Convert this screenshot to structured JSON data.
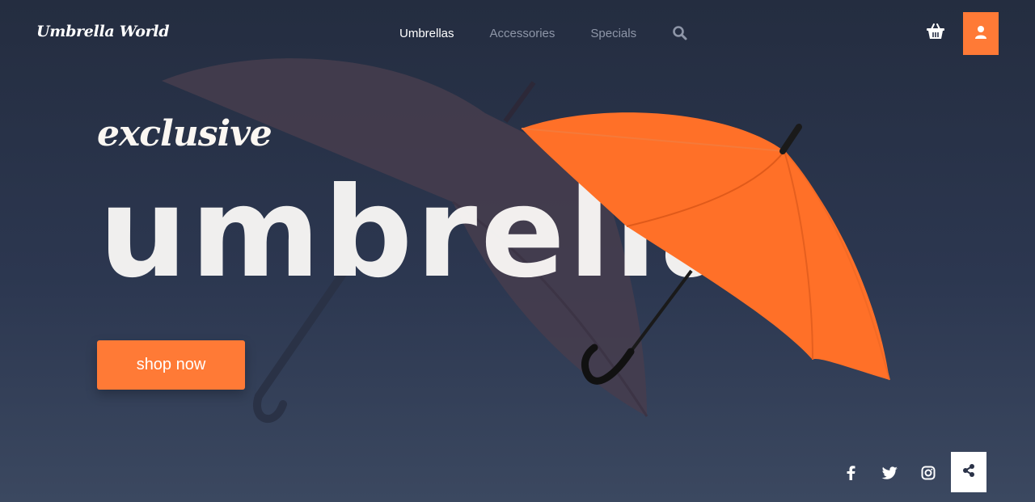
{
  "brand": {
    "logo_text": "Umbrella World"
  },
  "nav": {
    "items": [
      {
        "label": "Umbrellas",
        "active": true
      },
      {
        "label": "Accessories",
        "active": false
      },
      {
        "label": "Specials",
        "active": false
      }
    ],
    "search_icon": "search-icon"
  },
  "header_actions": {
    "cart_icon": "basket-icon",
    "user_icon": "user-icon"
  },
  "hero": {
    "eyebrow": "exclusive",
    "headline": "umbrella",
    "cta_label": "shop now",
    "images": [
      "orange-umbrella",
      "faded-umbrella"
    ]
  },
  "social": {
    "icons": [
      "facebook-icon",
      "twitter-icon",
      "instagram-icon"
    ],
    "share_icon": "share-icon"
  },
  "colors": {
    "accent": "#ff7a36",
    "background_top": "#242d40",
    "background_bottom": "#3b4860",
    "nav_inactive": "#8e96a8"
  }
}
